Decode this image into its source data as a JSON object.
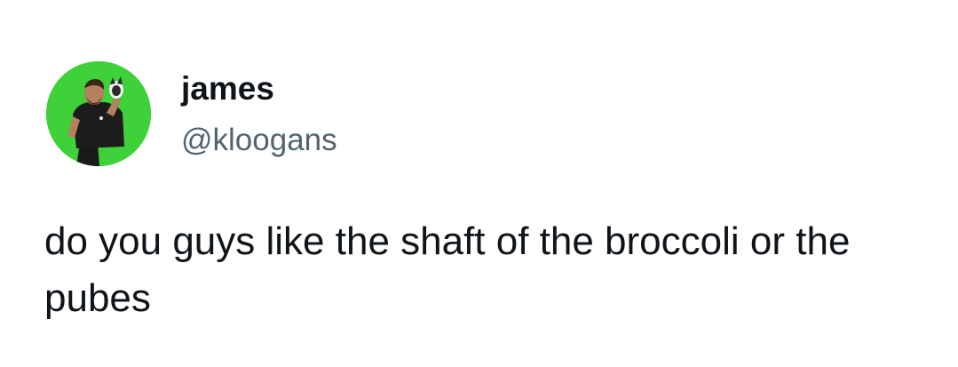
{
  "tweet": {
    "author": {
      "display_name": "james",
      "handle": "@kloogans",
      "avatar_icon": "profile-photo",
      "avatar_bg": "#3fd13a"
    },
    "text": "do you guys like the shaft of the broccoli or the pubes"
  },
  "colors": {
    "primary_text": "#0f1419",
    "secondary_text": "#536471",
    "background": "#ffffff"
  }
}
